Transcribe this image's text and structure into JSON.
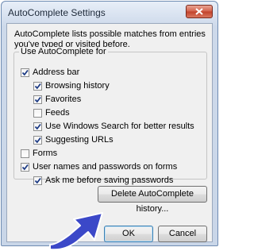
{
  "window": {
    "title": "AutoComplete Settings"
  },
  "intro_text": "AutoComplete lists possible matches from entries you've typed or visited before.",
  "group": {
    "label": "Use AutoComplete for"
  },
  "options": {
    "address_bar": {
      "label": "Address bar",
      "checked": true
    },
    "browsing_history": {
      "label": "Browsing history",
      "checked": true
    },
    "favorites": {
      "label": "Favorites",
      "checked": true
    },
    "feeds": {
      "label": "Feeds",
      "checked": false
    },
    "windows_search": {
      "label": "Use Windows Search for better results",
      "checked": true
    },
    "suggesting_urls": {
      "label": "Suggesting URLs",
      "checked": true
    },
    "forms": {
      "label": "Forms",
      "checked": false
    },
    "user_names_passwords": {
      "label": "User names and passwords on forms",
      "checked": true
    },
    "ask_before_saving": {
      "label": "Ask me before saving passwords",
      "checked": true
    }
  },
  "buttons": {
    "delete_history": "Delete AutoComplete history...",
    "ok": "OK",
    "cancel": "Cancel"
  },
  "annotation": {
    "icon": "pointer-arrow-icon",
    "color": "#3b48c8"
  }
}
